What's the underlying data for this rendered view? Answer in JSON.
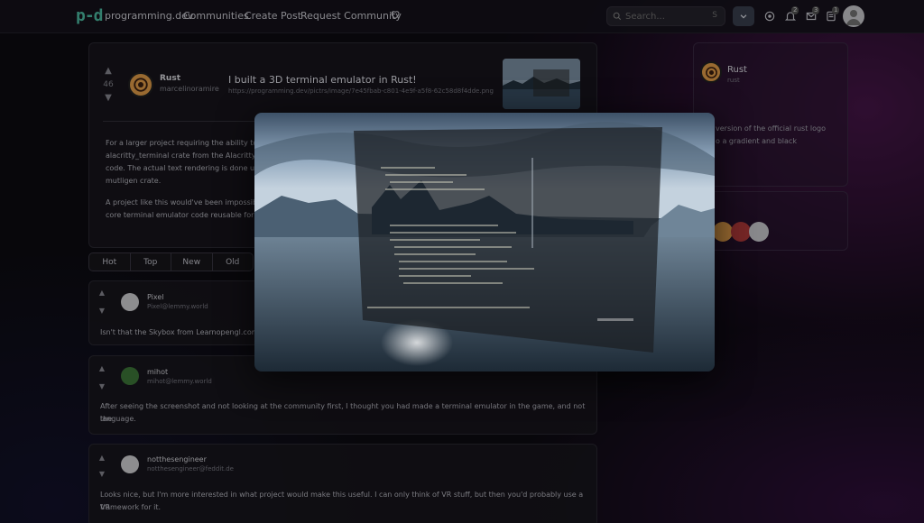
{
  "navbar": {
    "logo": "p-d",
    "site_name": "programming.dev",
    "links": [
      "Communities",
      "Create Post",
      "Request Community"
    ],
    "search_placeholder": "Search...",
    "search_shortcut": "S",
    "notif_counts": {
      "bell": "2",
      "inbox": "3",
      "reports": "1"
    }
  },
  "post": {
    "score": "46",
    "community": "Rust",
    "author": "marcelinoramire",
    "title": "I built a 3D terminal emulator in Rust!",
    "url": "https://programming.dev/pictrs/image/7e45fbab-c801-4e9f-a5f8-62c58d8f4dde.png",
    "body_lines": [
      "For a larger project requiring the ability to",
      "alacritty_terminal crate from the Alacritty t",
      "code. The actual text rendering is done us",
      "mutligen crate.",
      "A project like this would've been impossib",
      "core terminal emulator code reusable for e"
    ]
  },
  "sort_tabs": [
    "Hot",
    "Top",
    "New",
    "Old"
  ],
  "comments": [
    {
      "name": "Pixel",
      "instance": "Pixel@lemmy.world",
      "lines": [
        "Isn't that the Skybox from Learnopengl.com"
      ]
    },
    {
      "name": "mihot",
      "instance": "mihot@lemmy.world",
      "lines": [
        "After seeing the screenshot and not looking at the community first, I thought you had made a terminal emulator in the game, and not the",
        "language."
      ]
    },
    {
      "name": "notthesengineer",
      "instance": "notthesengineer@feddit.de",
      "lines": [
        "Looks nice, but I'm more interested in what project would make this useful. I can only think of VR stuff, but then you'd probably use a VR",
        "framework for it."
      ]
    }
  ],
  "sidebar": {
    "community_name": "Rust",
    "community_sub": "rust",
    "desc_lines": [
      "version of the official rust logo",
      "o a gradient and black"
    ]
  },
  "colors": {
    "accent": "#4ec0a6",
    "rust_orange": "#e9a24b",
    "background": "#0d0c12",
    "purple_glow": "#781e78"
  }
}
